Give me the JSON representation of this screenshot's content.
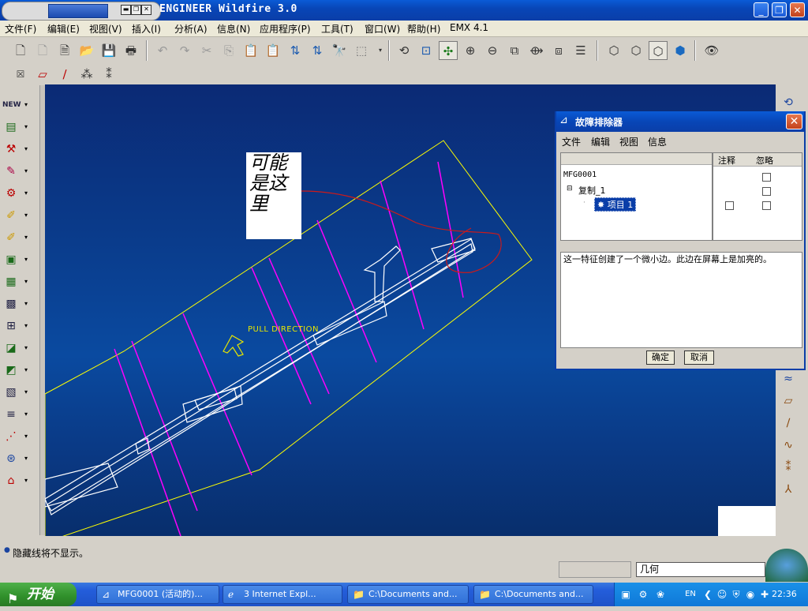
{
  "app": {
    "title": "ENGINEER Wildfire 3.0"
  },
  "menu": [
    "文件(F)",
    "编辑(E)",
    "视图(V)",
    "插入(I)",
    "分析(A)",
    "信息(N)",
    "应用程序(P)",
    "工具(T)",
    "窗口(W)",
    "帮助(H)",
    "EMX 4.1"
  ],
  "viewport": {
    "annotation_note": "可能是这里",
    "pull_direction_label": "PULL DIRECTION",
    "colors": {
      "model_outline": "#ffff00",
      "magenta": "#ff00ff",
      "white": "#ffffff",
      "red_sketch": "#cc1a1a"
    }
  },
  "dialog": {
    "title": "故障排除器",
    "menu": [
      "文件",
      "编辑",
      "视图",
      "信息"
    ],
    "columns": [
      "注释",
      "忽略"
    ],
    "tree": {
      "root": "MFG0001",
      "child": "复制_1",
      "leaf": "项目 1"
    },
    "message": "这一特征创建了一个微小边。此边在屏幕上是加亮的。",
    "ok_label": "确定",
    "cancel_label": "取消"
  },
  "status": {
    "message": "隐藏线将不显示。",
    "filter_value": "几何"
  },
  "taskbar": {
    "start_label": "开始",
    "tasks": [
      {
        "label": "MFG0001 (活动的)...",
        "icon": "proe-icon"
      },
      {
        "label": "3 Internet Expl...",
        "icon": "ie-icon"
      },
      {
        "label": "C:\\Documents and...",
        "icon": "folder-icon"
      },
      {
        "label": "C:\\Documents and...",
        "icon": "folder-icon"
      }
    ],
    "tray_lang": "EN",
    "clock": "22:36"
  }
}
